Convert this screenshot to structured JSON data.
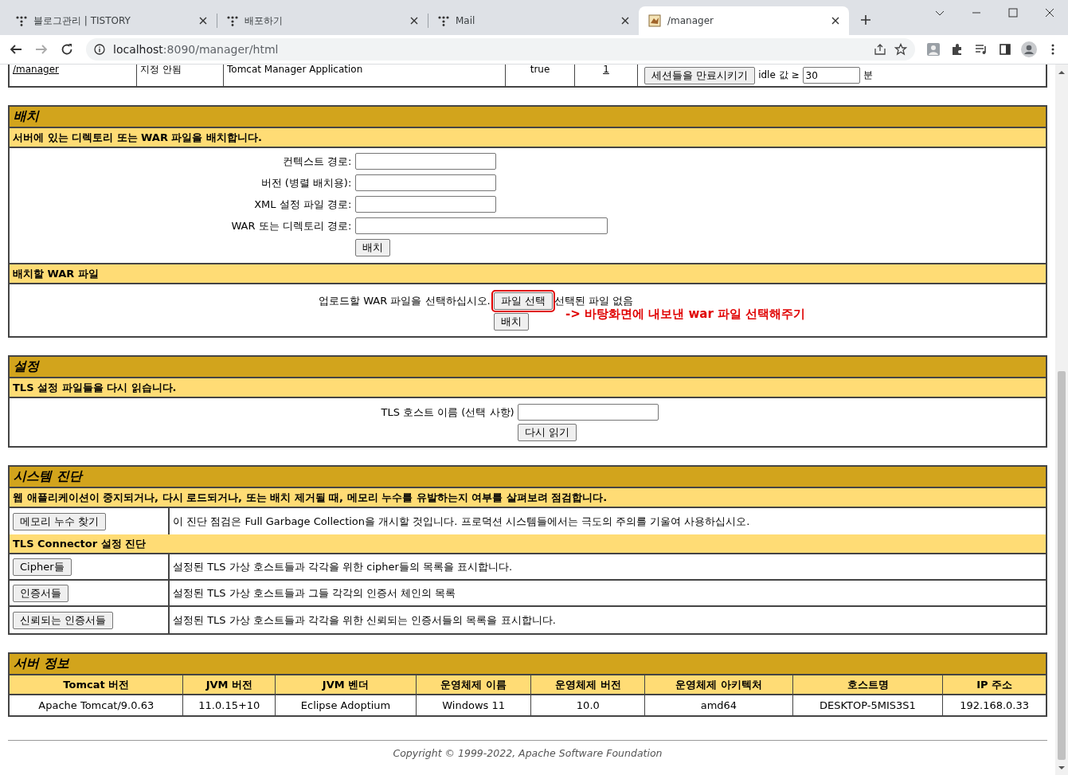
{
  "tabs": [
    {
      "title": "블로그관리 | TISTORY",
      "selected": false
    },
    {
      "title": "배포하기",
      "selected": false
    },
    {
      "title": "Mail",
      "selected": false
    },
    {
      "title": "/manager",
      "selected": true
    }
  ],
  "address": {
    "host": "localhost",
    "rest": ":8090/manager/html"
  },
  "app_row": {
    "path": "/manager",
    "version": "지정 안됨",
    "display_name": "Tomcat Manager Application",
    "running": "true",
    "sessions": "1",
    "expire_button": "세션들을 만료시키기",
    "idle_label": "idle 값 ≥",
    "idle_value": "30",
    "unit": "분"
  },
  "deploy": {
    "title": "배치",
    "subtitle": "서버에 있는 디렉토리 또는 WAR 파일을 배치합니다.",
    "fields": [
      {
        "label": "컨텍스트 경로:",
        "wide": false
      },
      {
        "label": "버전 (병렬 배치용):",
        "wide": false
      },
      {
        "label": "XML 설정 파일 경로:",
        "wide": false
      },
      {
        "label": "WAR 또는 디렉토리 경로:",
        "wide": true
      }
    ],
    "button": "배치",
    "upload_title": "배치할 WAR 파일",
    "upload_prompt": "업로드할 WAR 파일을 선택하십시오.",
    "file_button": "파일 선택",
    "file_button_highlighted": true,
    "file_status": "선택된 파일 없음",
    "upload_button": "배치",
    "annotation": "-> 바탕화면에 내보낸 war 파일 선택해주기"
  },
  "config": {
    "title": "설정",
    "subtitle": "TLS 설정 파일들을 다시 읽습니다.",
    "label": "TLS 호스트 이름 (선택 사항)",
    "button": "다시 읽기"
  },
  "diagnostics": {
    "title": "시스템 진단",
    "subtitle": "웹 애플리케이션이 중지되거나, 다시 로드되거나, 또는 배치 제거될 때, 메모리 누수를 유발하는지 여부를 살펴보려 점검합니다.",
    "rows": [
      {
        "button": "메모리 누수 찾기",
        "text": "이 진단 점검은 Full Garbage Collection을 개시할 것입니다. 프로덕션 시스템들에서는 극도의 주의를 기울여 사용하십시오."
      }
    ],
    "tls_title": "TLS Connector 설정 진단",
    "tls_rows": [
      {
        "button": "Cipher들",
        "text": "설정된 TLS 가상 호스트들과 각각을 위한 cipher들의 목록을 표시합니다."
      },
      {
        "button": "인증서들",
        "text": "설정된 TLS 가상 호스트들과 그들 각각의 인증서 체인의 목록"
      },
      {
        "button": "신뢰되는 인증서들",
        "text": "설정된 TLS 가상 호스트들과 각각을 위한 신뢰되는 인증서들의 목록을 표시합니다."
      }
    ]
  },
  "server_info": {
    "title": "서버 정보",
    "columns": [
      "Tomcat 버전",
      "JVM 버전",
      "JVM 벤더",
      "운영체제 이름",
      "운영체제 버전",
      "운영체제 아키텍처",
      "호스트명",
      "IP 주소"
    ],
    "values": [
      "Apache Tomcat/9.0.63",
      "11.0.15+10",
      "Eclipse Adoptium",
      "Windows 11",
      "10.0",
      "amd64",
      "DESKTOP-5MIS3S1",
      "192.168.0.33"
    ]
  },
  "footer": "Copyright © 1999-2022, Apache Software Foundation"
}
